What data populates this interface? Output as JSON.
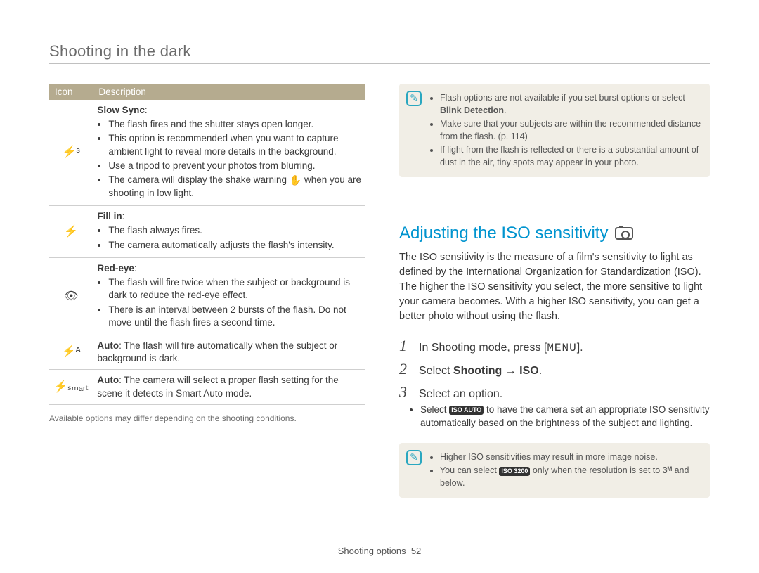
{
  "header": {
    "section_title": "Shooting in the dark"
  },
  "flash_table": {
    "col_icon": "Icon",
    "col_desc": "Description",
    "rows": [
      {
        "icon": "⚡ˢ",
        "title": "Slow Sync",
        "bullets": [
          "The flash fires and the shutter stays open longer.",
          "This option is recommended when you want to capture ambient light to reveal more details in the background.",
          "Use a tripod to prevent your photos from blurring.",
          "The camera will display the shake warning ✋ when you are shooting in low light."
        ]
      },
      {
        "icon": "⚡",
        "title": "Fill in",
        "bullets": [
          "The flash always fires.",
          "The camera automatically adjusts the flash's intensity."
        ]
      },
      {
        "icon": "👁",
        "title": "Red-eye",
        "bullets": [
          "The flash will fire twice when the subject or background is dark to reduce the red-eye effect.",
          "There is an interval between 2 bursts of the flash. Do not move until the flash fires a second time."
        ]
      },
      {
        "icon": "⚡ᴬ",
        "plain_before": "Auto",
        "plain_after": ": The flash will fire automatically when the subject or background is dark."
      },
      {
        "icon": "⚡ₛₘₐᵣₜ",
        "plain_before": "Auto",
        "plain_after": ": The camera will select a proper flash setting for the scene it detects in Smart Auto mode."
      }
    ],
    "footnote": "Available options may differ depending on the shooting conditions."
  },
  "note1": {
    "items": [
      {
        "pre": "Flash options are not available if you set burst options or select ",
        "bold": "Blink Detection",
        "post": "."
      },
      {
        "pre": "Make sure that your subjects are within the recommended distance from the flash. (p. 114)",
        "bold": "",
        "post": ""
      },
      {
        "pre": "If light from the flash is reflected or there is a substantial amount of dust in the air, tiny spots may appear in your photo.",
        "bold": "",
        "post": ""
      }
    ]
  },
  "iso": {
    "heading": "Adjusting the ISO sensitivity",
    "para": "The ISO sensitivity is the measure of a film's sensitivity to light as defined by the International Organization for Standardization (ISO). The higher the ISO sensitivity you select, the more sensitive to light your camera becomes. With a higher ISO sensitivity, you can get a better photo without using the flash.",
    "steps": {
      "s1_pre": "In Shooting mode, press [",
      "s1_kbd": "MENU",
      "s1_post": "].",
      "s2_pre": "Select ",
      "s2_bold1": "Shooting",
      "s2_arrow": " → ",
      "s2_bold2": "ISO",
      "s2_post": ".",
      "s3": "Select an option.",
      "s3_sub_pre": "Select ",
      "s3_sub_icon": "ISO AUTO",
      "s3_sub_post": " to have the camera set an appropriate ISO sensitivity automatically based on the brightness of the subject and lighting."
    }
  },
  "note2": {
    "items": [
      "Higher ISO sensitivities may result in more image noise.",
      "You can select ISO 3200 only when the resolution is set to 3ᴹ and below."
    ],
    "iso_badge": "ISO 3200",
    "res_badge": "3ᴹ"
  },
  "footer": {
    "label": "Shooting options",
    "page": "52"
  }
}
